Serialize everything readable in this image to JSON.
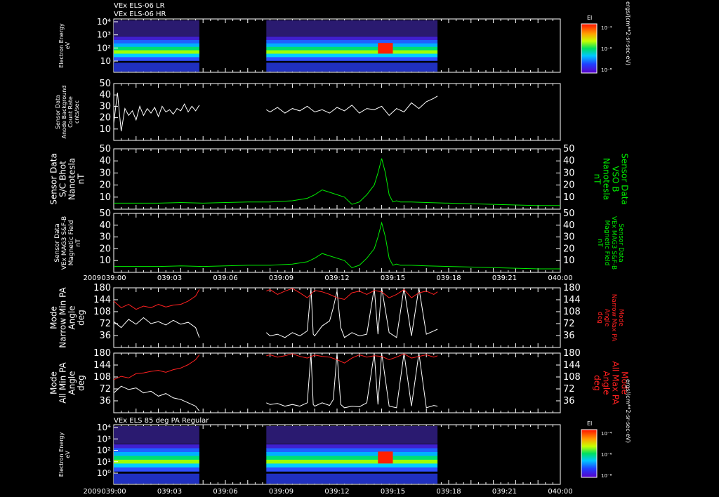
{
  "colors": {
    "background": "#000000",
    "white": "#ffffff",
    "green": "#00ee00",
    "red": "#ff2020"
  },
  "header": {
    "line1": "VEx ELS-06 LR",
    "line2": "VEx ELS-06 HR"
  },
  "time_axis": {
    "year": "2009",
    "ticks": [
      "039:00",
      "039:03",
      "039:06",
      "039:09",
      "039:12",
      "039:15",
      "039:18",
      "039:21",
      "040:00"
    ],
    "range_minutes": [
      0,
      60
    ]
  },
  "chart_data": [
    {
      "type": "heatmap",
      "ylabel": "Electron Energy\neV",
      "y_ticks": [
        "10",
        "10²",
        "10³",
        "10⁴"
      ],
      "colorbar": {
        "label": "EI",
        "ticks": [
          "10⁻⁴",
          "10⁻⁶",
          "10⁻⁸"
        ]
      },
      "units": "ergs/(cm**2-sr-sec-eV)",
      "data_gaps_minutes": [
        [
          11.5,
          20.5
        ]
      ],
      "coverage_minutes": [
        0,
        43.5
      ]
    },
    {
      "type": "line",
      "ylabel": "Sensor Data\nAnode Background\nCount Rate\ncnts/sec",
      "ylim": [
        0,
        50
      ],
      "y_ticks": [
        10,
        20,
        30,
        40,
        50
      ],
      "series": [
        {
          "color": "white",
          "x": [
            0,
            0.5,
            1,
            1.5,
            2,
            2.5,
            3,
            3.5,
            4,
            4.5,
            5,
            5.5,
            6,
            6.5,
            7,
            7.5,
            8,
            8.5,
            9,
            9.5,
            10,
            10.5,
            11,
            11.5,
            null,
            20.5,
            21,
            22,
            23,
            24,
            25,
            26,
            27,
            28,
            29,
            30,
            31,
            32,
            33,
            34,
            35,
            36,
            37,
            38,
            39,
            40,
            41,
            42,
            43,
            43.5
          ],
          "y": [
            15,
            42,
            8,
            28,
            22,
            26,
            18,
            30,
            22,
            28,
            24,
            29,
            21,
            30,
            25,
            27,
            23,
            28,
            26,
            32,
            25,
            30,
            26,
            31,
            null,
            27,
            25,
            29,
            24,
            28,
            26,
            30,
            25,
            27,
            24,
            29,
            26,
            31,
            24,
            28,
            27,
            30,
            22,
            28,
            25,
            33,
            28,
            34,
            37,
            39
          ]
        }
      ]
    },
    {
      "type": "line",
      "ylabel": "Sensor Data\nS/C Bhot\nNanotesla\nnT",
      "right_label": "Sensor Data\nVSO B\nNanotesla\nnT",
      "ylim": [
        0,
        50
      ],
      "y_ticks": [
        10,
        20,
        30,
        40,
        50
      ],
      "series": [
        {
          "color": "green",
          "x": [
            0,
            3,
            6,
            9,
            12,
            15,
            18,
            21,
            24,
            26,
            27,
            28,
            29,
            30,
            31,
            32,
            33,
            34,
            35,
            35.5,
            36,
            36.5,
            37,
            37.5,
            38,
            38.5,
            39,
            40,
            42,
            45,
            48,
            51,
            54,
            57,
            60
          ],
          "y": [
            5,
            5,
            5,
            5.5,
            5,
            5.5,
            6,
            6,
            7,
            9,
            12,
            16,
            14,
            12,
            10,
            4,
            6,
            12,
            20,
            30,
            42,
            30,
            12,
            6,
            7,
            6,
            6,
            6,
            5.5,
            5,
            4.5,
            4,
            3.5,
            3,
            3
          ]
        }
      ]
    },
    {
      "type": "line",
      "ylabel": "Sensor Data\nVEx MAG3 S&F-B\nMagnetic Field\nnT",
      "right_label": "Sensor Data\nVEx MAG3 S&F-B\nMagnetic Field\nnT",
      "ylim": [
        0,
        50
      ],
      "y_ticks": [
        10,
        20,
        30,
        40,
        50
      ],
      "series": [
        {
          "color": "green",
          "x": [
            0,
            3,
            6,
            9,
            12,
            15,
            18,
            21,
            24,
            26,
            27,
            28,
            29,
            30,
            31,
            32,
            33,
            34,
            35,
            35.5,
            36,
            36.5,
            37,
            37.5,
            38,
            38.5,
            39,
            40,
            42,
            45,
            48,
            51,
            54,
            57,
            60
          ],
          "y": [
            5,
            5,
            5,
            5.5,
            5,
            5.5,
            6,
            6,
            7,
            9,
            12,
            16,
            14,
            12,
            10,
            4,
            6,
            12,
            20,
            30,
            42,
            30,
            12,
            6,
            7,
            6,
            6,
            6,
            5.5,
            5,
            4.5,
            4,
            3.5,
            3,
            3
          ]
        }
      ]
    },
    {
      "type": "line",
      "ylabel": "Mode\nNarrow Min PA\nAngle\ndeg",
      "right_label": "Mode\nNarrow Max PA\nAngle\ndeg",
      "ylim": [
        0,
        180
      ],
      "y_ticks": [
        36,
        72,
        108,
        144,
        180
      ],
      "series": [
        {
          "color": "white",
          "x": [
            0,
            1,
            2,
            3,
            4,
            5,
            6,
            7,
            8,
            9,
            10,
            11,
            11.5,
            null,
            20.5,
            21,
            22,
            23,
            24,
            25,
            26,
            26.5,
            26.8,
            27,
            28,
            29,
            29.5,
            30,
            30.5,
            31,
            32,
            33,
            34,
            35,
            35.5,
            36,
            37,
            38,
            39,
            40,
            41,
            42,
            43,
            43.5
          ],
          "y": [
            78,
            60,
            85,
            70,
            90,
            72,
            78,
            68,
            82,
            70,
            76,
            60,
            30,
            null,
            45,
            35,
            40,
            30,
            45,
            35,
            50,
            180,
            40,
            35,
            65,
            80,
            120,
            170,
            60,
            30,
            45,
            35,
            40,
            180,
            40,
            180,
            45,
            30,
            180,
            35,
            180,
            40,
            50,
            55
          ]
        },
        {
          "color": "red",
          "x": [
            0,
            1,
            2,
            3,
            4,
            5,
            6,
            7,
            8,
            9,
            10,
            11,
            11.5,
            null,
            20.5,
            21,
            22,
            23,
            24,
            25,
            26,
            27,
            28,
            29,
            30,
            31,
            32,
            33,
            34,
            35,
            36,
            37,
            38,
            39,
            40,
            41,
            42,
            43,
            43.5
          ],
          "y": [
            140,
            120,
            130,
            115,
            125,
            120,
            130,
            122,
            128,
            130,
            140,
            155,
            175,
            null,
            170,
            175,
            160,
            170,
            178,
            165,
            150,
            172,
            168,
            160,
            150,
            145,
            165,
            170,
            160,
            172,
            168,
            150,
            160,
            175,
            150,
            165,
            170,
            160,
            168
          ]
        }
      ]
    },
    {
      "type": "line",
      "ylabel": "Mode\nAll Min PA\nAngle\ndeg",
      "right_label": "Mode\nAll Max PA\nAngle\ndeg",
      "ylim": [
        0,
        180
      ],
      "y_ticks": [
        36,
        72,
        108,
        144,
        180
      ],
      "series": [
        {
          "color": "white",
          "x": [
            0,
            1,
            2,
            3,
            4,
            5,
            6,
            7,
            8,
            9,
            10,
            11,
            11.5,
            null,
            20.5,
            21,
            22,
            23,
            24,
            25,
            26,
            26.5,
            26.8,
            27,
            28,
            29,
            29.5,
            30,
            30.5,
            31,
            32,
            33,
            34,
            35,
            35.5,
            36,
            37,
            38,
            39,
            40,
            41,
            42,
            43,
            43.5
          ],
          "y": [
            60,
            80,
            70,
            75,
            60,
            65,
            50,
            58,
            45,
            40,
            30,
            20,
            5,
            null,
            30,
            25,
            28,
            20,
            25,
            20,
            30,
            180,
            25,
            20,
            30,
            22,
            40,
            180,
            25,
            15,
            20,
            18,
            30,
            180,
            25,
            180,
            20,
            15,
            180,
            20,
            180,
            15,
            22,
            20
          ]
        },
        {
          "color": "red",
          "x": [
            0,
            1,
            2,
            3,
            4,
            5,
            6,
            7,
            8,
            9,
            10,
            11,
            11.5,
            null,
            20.5,
            21,
            22,
            23,
            24,
            25,
            26,
            27,
            28,
            29,
            30,
            31,
            32,
            33,
            34,
            35,
            36,
            37,
            38,
            39,
            40,
            41,
            42,
            43,
            43.5
          ],
          "y": [
            100,
            110,
            105,
            118,
            120,
            125,
            128,
            122,
            130,
            135,
            145,
            160,
            175,
            null,
            172,
            175,
            168,
            172,
            178,
            170,
            165,
            174,
            170,
            168,
            160,
            150,
            165,
            175,
            168,
            172,
            170,
            160,
            168,
            178,
            165,
            170,
            175,
            168,
            172
          ]
        }
      ]
    },
    {
      "type": "heatmap",
      "title": "VEx ELS 85 deg PA Regular",
      "ylabel": "Electron Energy\neV",
      "y_ticks": [
        "10⁰",
        "10¹",
        "10²",
        "10³",
        "10⁴"
      ],
      "colorbar": {
        "label": "EI",
        "ticks": [
          "10⁻⁴",
          "10⁻⁶",
          "10⁻⁸"
        ]
      },
      "units": "ergs/(cm**2-sr-sec-eV)",
      "data_gaps_minutes": [
        [
          11.5,
          20.5
        ]
      ],
      "coverage_minutes": [
        0,
        43.5
      ]
    }
  ]
}
